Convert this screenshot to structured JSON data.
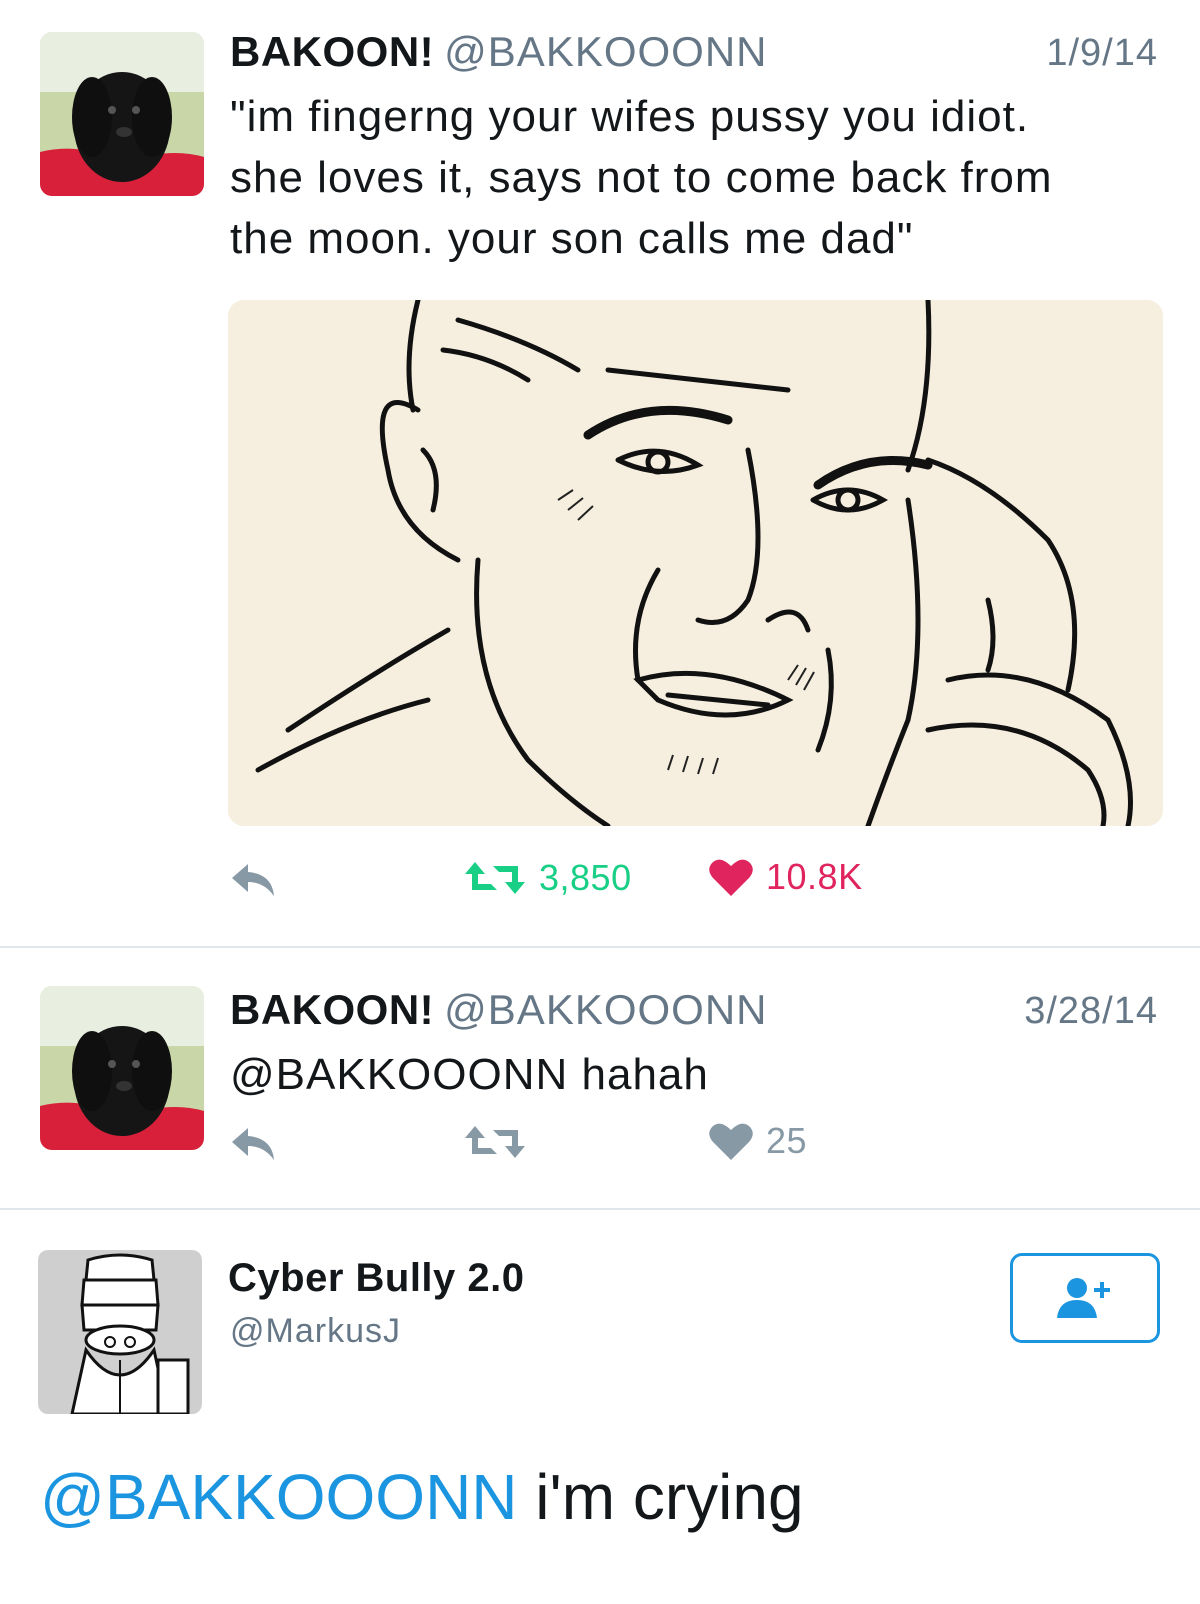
{
  "tweets": [
    {
      "name": "BAKOON!",
      "handle": "@BAKKOOONN",
      "date": "1/9/14",
      "lines": [
        "\"im fingerng your wifes pussy you idiot.",
        "she loves it, says not to come back from",
        "the moon. your son calls me dad\""
      ],
      "has_media": true,
      "retweets": "3,850",
      "likes": "10.8K",
      "liked": true
    },
    {
      "name": "BAKOON!",
      "handle": "@BAKKOOONN",
      "date": "3/28/14",
      "text": "@BAKKOOONN hahah",
      "retweets": "",
      "likes": "25",
      "liked": false
    }
  ],
  "quote": {
    "name": "Cyber Bully 2.0",
    "handle": "@MarkusJ",
    "mention": "@BAKKOOONN",
    "text": " i'm crying"
  },
  "colors": {
    "retweet": "#19cf86",
    "like": "#e0245e",
    "icon_gray": "#8899a6",
    "link": "#1b95e0"
  },
  "icons": [
    "reply-icon",
    "retweet-icon",
    "heart-icon",
    "follow-user-icon"
  ]
}
